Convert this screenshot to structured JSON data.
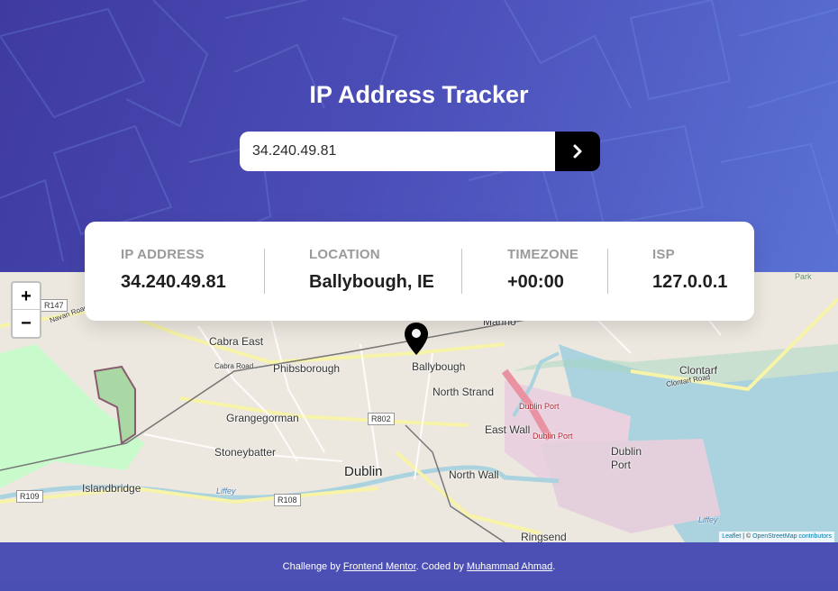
{
  "header": {
    "title": "IP Address Tracker"
  },
  "search": {
    "value": "34.240.49.81",
    "submit_icon": "chevron-right-icon"
  },
  "info": {
    "ip": {
      "label": "IP ADDRESS",
      "value": "34.240.49.81"
    },
    "location": {
      "label": "LOCATION",
      "value": "Ballybough, IE"
    },
    "timezone": {
      "label": "TIMEZONE",
      "value": "+00:00"
    },
    "isp": {
      "label": "ISP",
      "value": "127.0.0.1"
    }
  },
  "map": {
    "zoom_in": "+",
    "zoom_out": "−",
    "marker_icon": "map-pin-icon",
    "labels": {
      "cabra_east": "Cabra East",
      "phibsborough": "Phibsborough",
      "ballybough": "Ballybough",
      "north_strand": "North Strand",
      "clontarf": "Clontarf",
      "grangegorman": "Grangegorman",
      "stoneybatter": "Stoneybatter",
      "dublin": "Dublin",
      "east_wall": "East Wall",
      "dublin_port": "Dublin Port",
      "dublin_port_area": "Dublin Port",
      "north_wall": "North Wall",
      "islandbridge": "Islandbridge",
      "ringsend": "Ringsend",
      "marino": "Marino",
      "park": "Park",
      "cabra_road": "Cabra Road",
      "navan_road": "Navan Road",
      "clontarf_road": "Clontarf Road",
      "liffey": "Liffey",
      "r147": "R147",
      "r802": "R802",
      "r108": "R108",
      "r109": "R109"
    },
    "attribution": {
      "leaflet": "Leaflet",
      "separator": " | © ",
      "osm": "OpenStreetMap contributors"
    }
  },
  "footer": {
    "prefix": "Challenge by ",
    "fm_link": "Frontend Mentor",
    "middle": ". Coded by ",
    "author_link": "Muhammad Ahmad",
    "suffix": "."
  },
  "colors": {
    "hero_start": "#3e3aa0",
    "hero_end": "#5a72d4",
    "button": "#000000",
    "sea": "#aad3df",
    "park": "#c8facc",
    "port": "#e9d1e0"
  }
}
